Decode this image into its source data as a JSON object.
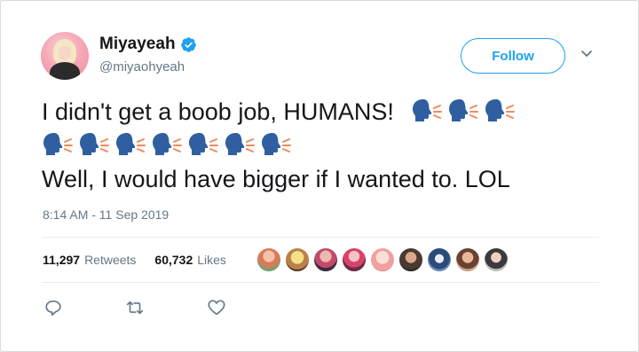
{
  "user": {
    "display_name": "Miyayeah",
    "handle": "@miyaohyeah",
    "verified": true
  },
  "follow_button": {
    "label": "Follow"
  },
  "tweet": {
    "lines": [
      "I didn't get a boob job, HUMANS!",
      "",
      "Well, I would have bigger if I wanted to. LOL"
    ],
    "emoji": "speaking-head-icon",
    "emoji_count_line1": 3,
    "emoji_count_line2": 7,
    "timestamp": "8:14 AM - 11 Sep 2019"
  },
  "stats": {
    "retweets_count": "11,297",
    "retweets_label": "Retweets",
    "likes_count": "60,732",
    "likes_label": "Likes"
  },
  "likers_count": 9,
  "colors": {
    "accent": "#1da1f2",
    "muted": "#657786",
    "emoji_head": "#2f5fa0",
    "emoji_breath": "#f08a5a"
  }
}
